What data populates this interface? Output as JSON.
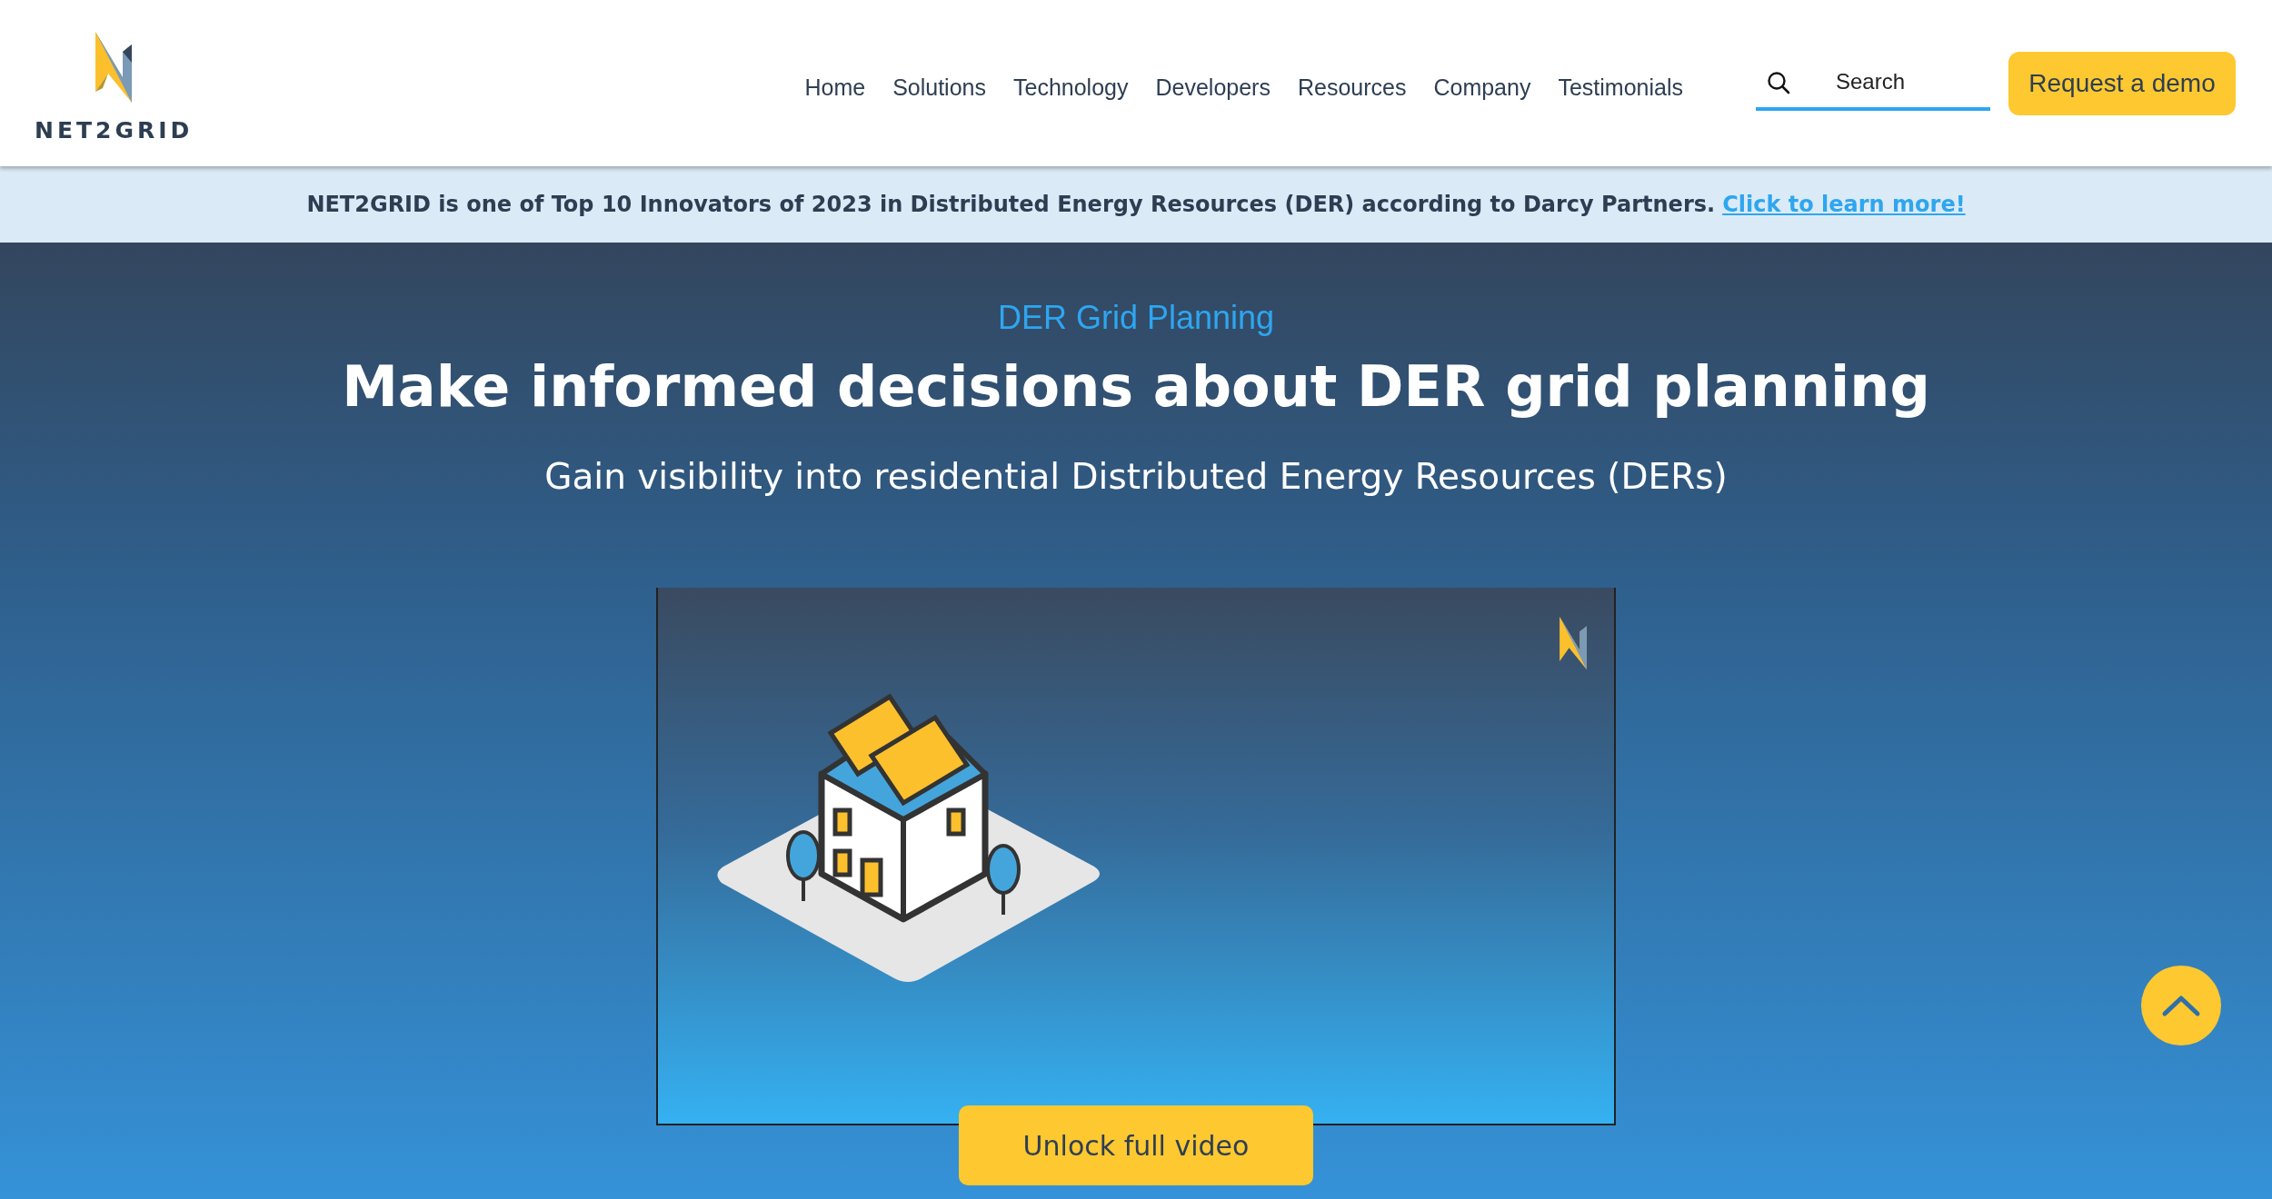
{
  "header": {
    "logo": {
      "text": "NET2GRID"
    },
    "nav": [
      {
        "label": "Home"
      },
      {
        "label": "Solutions"
      },
      {
        "label": "Technology"
      },
      {
        "label": "Developers"
      },
      {
        "label": "Resources"
      },
      {
        "label": "Company"
      },
      {
        "label": "Testimonials"
      }
    ],
    "search": {
      "placeholder": "Search"
    },
    "cta": "Request a demo"
  },
  "announcement": {
    "text": "NET2GRID is one of Top 10 Innovators of 2023 in Distributed Energy Resources (DER) according to Darcy Partners.",
    "link": "Click to learn more!"
  },
  "hero": {
    "eyebrow": "DER Grid Planning",
    "title": "Make informed decisions about DER grid planning",
    "subtitle": "Gain visibility into residential Distributed Energy Resources (DERs)",
    "video_button": "Unlock full video"
  }
}
